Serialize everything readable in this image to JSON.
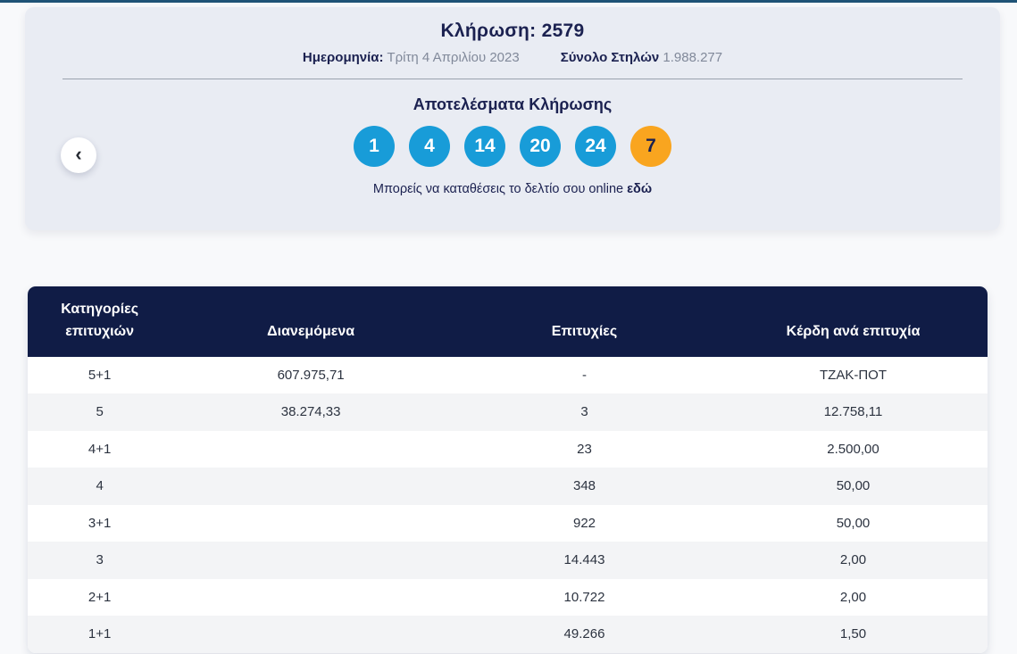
{
  "page": {
    "accent_bar_color": "#1f5376",
    "ball_blue": "#189cd8",
    "ball_orange": "#f9a51f"
  },
  "nav": {
    "prev_icon": "‹"
  },
  "draw_card": {
    "title": "Κλήρωση: 2579",
    "date_label": "Ημερομηνία:",
    "date_value": "Τρίτη 4 Απριλίου 2023",
    "columns_label": "Σύνολο Στηλών",
    "columns_value": "1.988.277",
    "results_heading": "Αποτελέσματα Κλήρωσης",
    "numbers": [
      "1",
      "4",
      "14",
      "20",
      "24"
    ],
    "joker_number": "7",
    "caption_text": "Μπορείς να καταθέσεις το δελτίο σου online",
    "caption_link": "εδώ"
  },
  "table": {
    "headers": [
      "Κατηγορίες επιτυχιών",
      "Διανεμόμενα",
      "Επιτυχίες",
      "Κέρδη ανά επιτυχία"
    ],
    "rows": [
      {
        "category": "5+1",
        "distributed": "607.975,71",
        "winners": "-",
        "prize": "ΤΖΑΚ-ΠΟΤ"
      },
      {
        "category": "5",
        "distributed": "38.274,33",
        "winners": "3",
        "prize": "12.758,11"
      },
      {
        "category": "4+1",
        "distributed": "",
        "winners": "23",
        "prize": "2.500,00"
      },
      {
        "category": "4",
        "distributed": "",
        "winners": "348",
        "prize": "50,00"
      },
      {
        "category": "3+1",
        "distributed": "",
        "winners": "922",
        "prize": "50,00"
      },
      {
        "category": "3",
        "distributed": "",
        "winners": "14.443",
        "prize": "2,00"
      },
      {
        "category": "2+1",
        "distributed": "",
        "winners": "10.722",
        "prize": "2,00"
      },
      {
        "category": "1+1",
        "distributed": "",
        "winners": "49.266",
        "prize": "1,50"
      }
    ]
  }
}
